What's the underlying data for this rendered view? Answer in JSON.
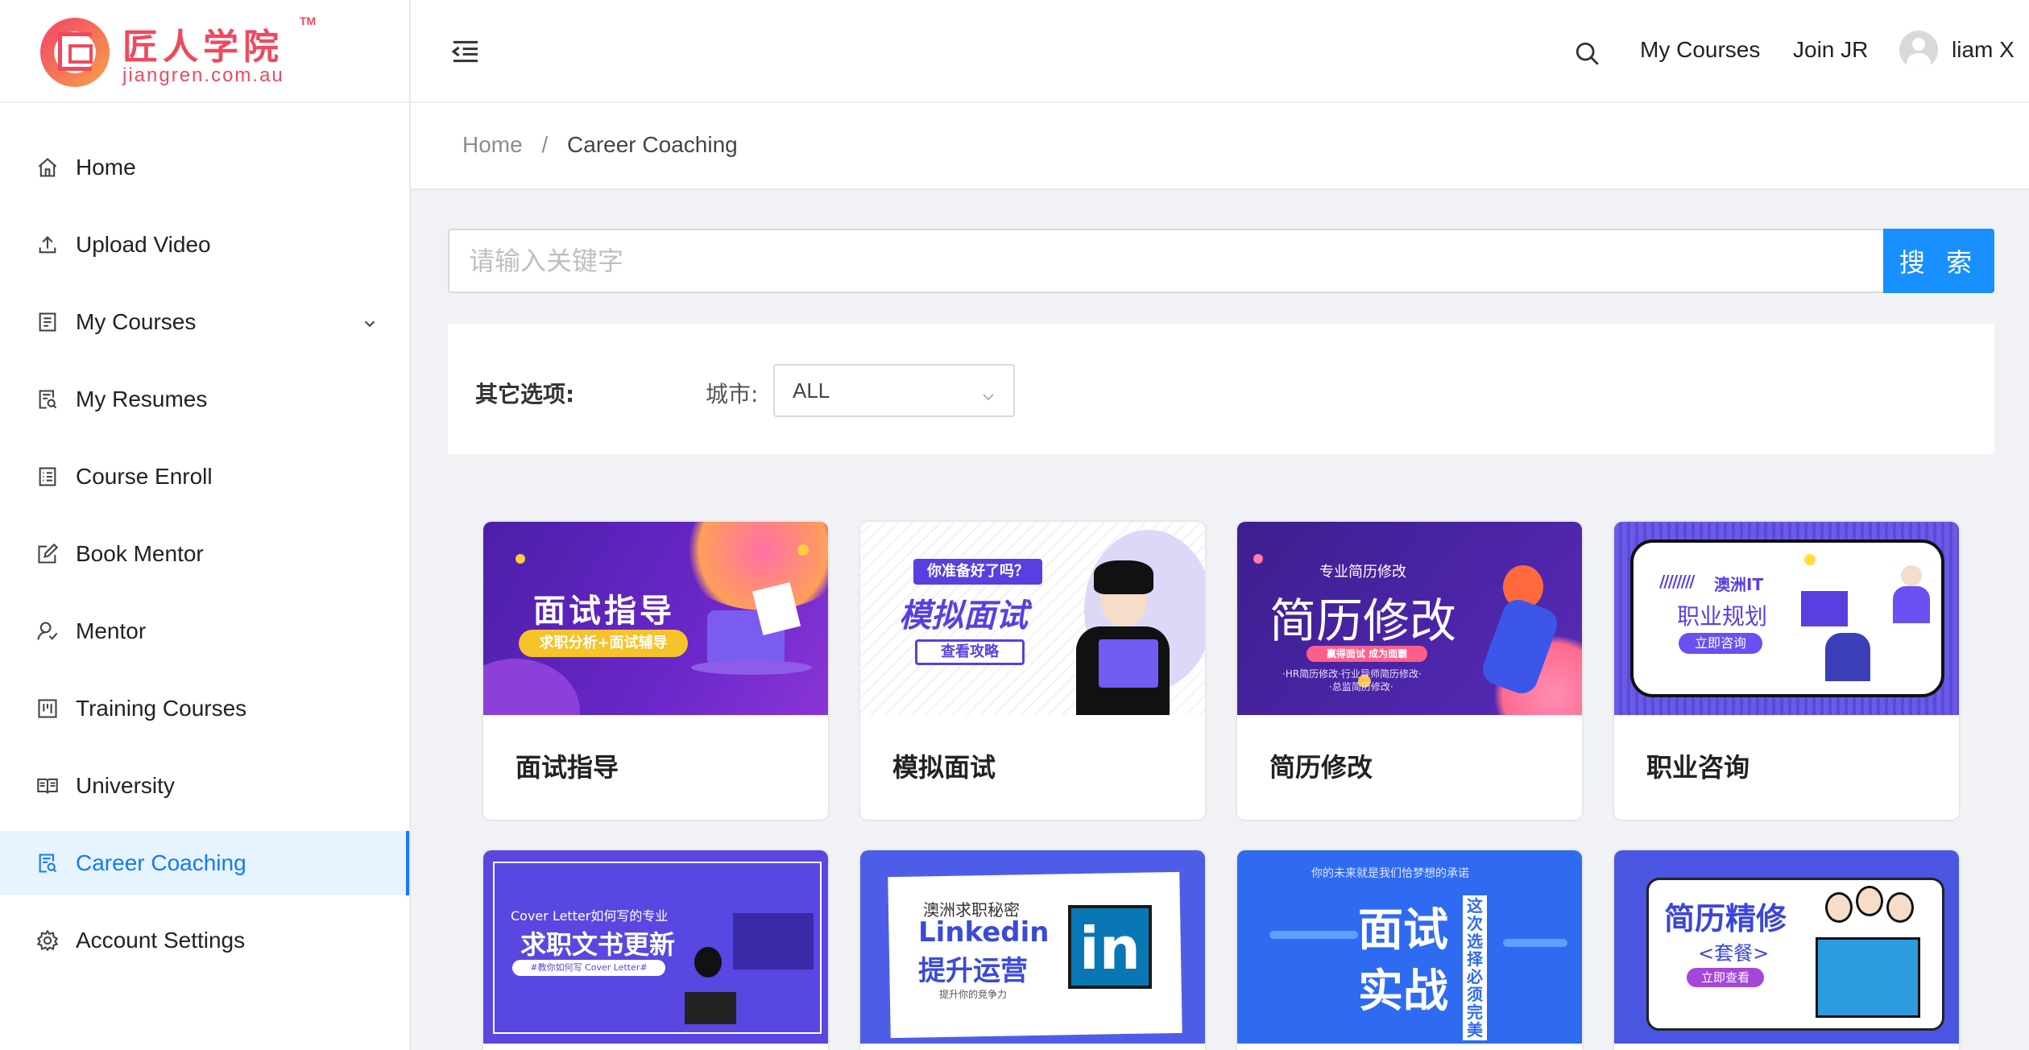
{
  "logo": {
    "title": "匠人学院",
    "subtitle": "jiangren.com.au",
    "tm": "TM"
  },
  "sidebar": {
    "items": [
      {
        "label": "Home",
        "icon": "home-icon"
      },
      {
        "label": "Upload Video",
        "icon": "upload-icon"
      },
      {
        "label": "My Courses",
        "icon": "courses-icon",
        "expandable": true
      },
      {
        "label": "My Resumes",
        "icon": "resume-icon"
      },
      {
        "label": "Course Enroll",
        "icon": "list-icon"
      },
      {
        "label": "Book Mentor",
        "icon": "edit-icon"
      },
      {
        "label": "Mentor",
        "icon": "user-icon"
      },
      {
        "label": "Training Courses",
        "icon": "board-icon"
      },
      {
        "label": "University",
        "icon": "book-icon"
      },
      {
        "label": "Career Coaching",
        "icon": "resume-icon",
        "active": true
      },
      {
        "label": "Account Settings",
        "icon": "gear-icon"
      }
    ]
  },
  "header": {
    "my_courses": "My Courses",
    "join": "Join JR",
    "user": "liam X"
  },
  "breadcrumb": {
    "home": "Home",
    "sep": "/",
    "current": "Career Coaching"
  },
  "search": {
    "placeholder": "请输入关键字",
    "button": "搜 索"
  },
  "filter": {
    "label": "其它选项:",
    "city_label": "城市:",
    "city_value": "ALL"
  },
  "cards": [
    {
      "title": "面试指导",
      "banner_heading": "面试指导",
      "banner_pill": "求职分析+面试辅导"
    },
    {
      "title": "模拟面试",
      "banner_top": "你准备好了吗？",
      "banner_heading": "模拟面试",
      "banner_pill": "查看攻略"
    },
    {
      "title": "简历修改",
      "banner_top": "专业简历修改",
      "banner_heading": "简历修改",
      "banner_pill": "赢得面试 成为面霸",
      "banner_note1": "·HR简历修改·行业导师简历修改·",
      "banner_note2": "·总监简历修改·"
    },
    {
      "title": "职业咨询",
      "banner_top": "澳洲IT",
      "banner_heading": "职业规划",
      "banner_pill": "立即咨询"
    }
  ],
  "cards_row2": [
    {
      "banner_top": "Cover Letter如何写的专业",
      "banner_heading": "求职文书更新",
      "banner_note": "#教你如何写 Cover Letter#"
    },
    {
      "banner_top": "澳洲求职秘密",
      "banner_heading1": "Linkedin",
      "banner_heading2": "提升运营",
      "banner_note": "提升你的竞争力",
      "logo_text": "in"
    },
    {
      "banner_top": "你的未来就是我们恰梦想的承诺",
      "banner_heading1": "面试",
      "banner_heading2": "实战",
      "banner_side": "这次选择必须完美"
    },
    {
      "banner_heading": "简历精修",
      "banner_sub": "<套餐>",
      "banner_pill": "立即查看"
    }
  ],
  "colors": {
    "accent": "#1890ff",
    "active_bg": "#e6f4ff",
    "brand": "#ee4a5e"
  }
}
